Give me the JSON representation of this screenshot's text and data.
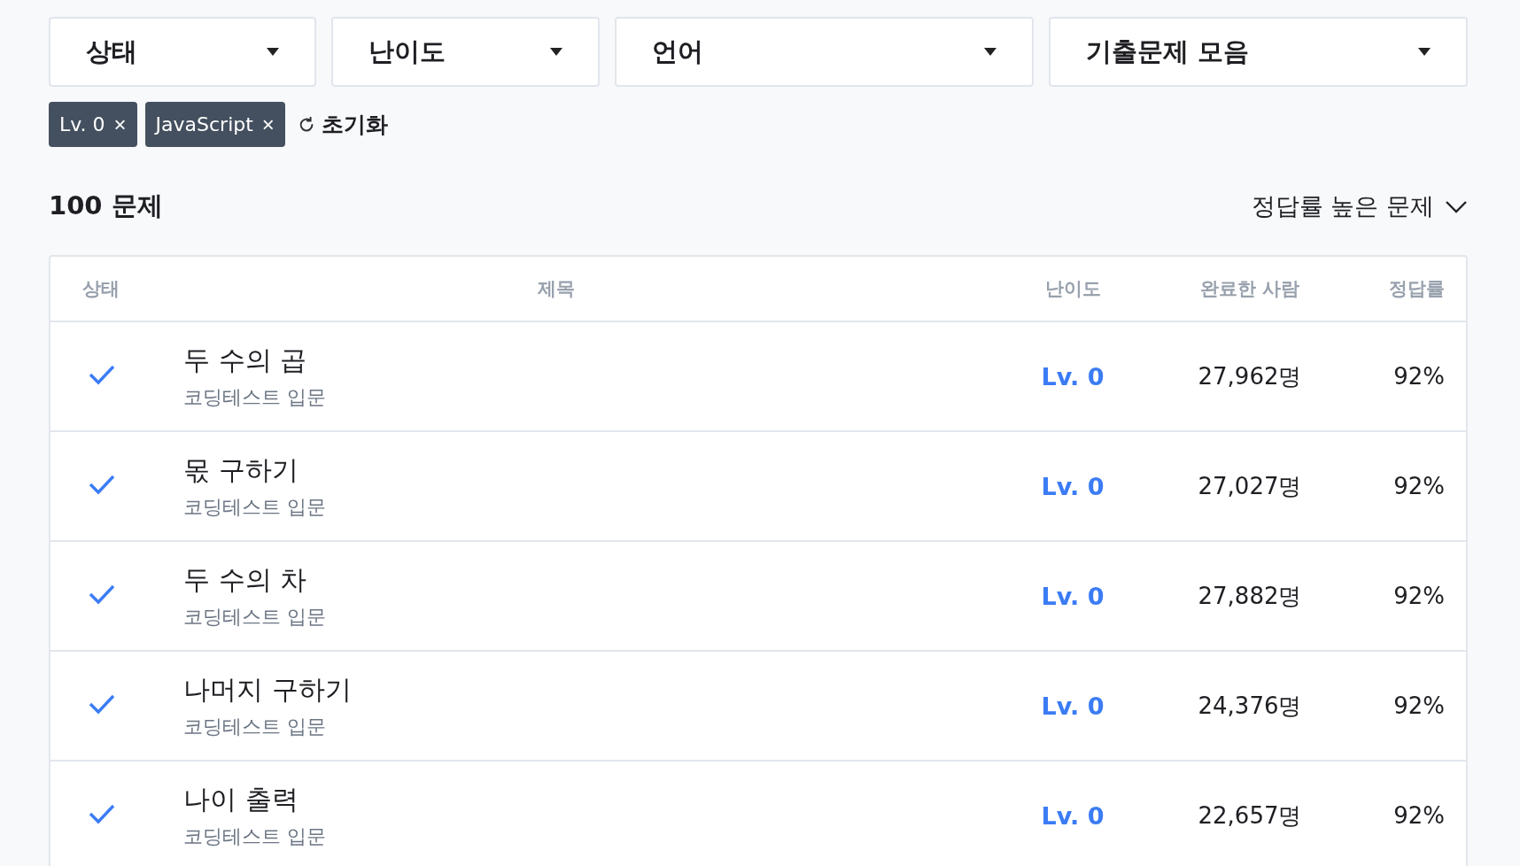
{
  "filters": [
    {
      "label": "상태"
    },
    {
      "label": "난이도"
    },
    {
      "label": "언어"
    },
    {
      "label": "기출문제 모음"
    }
  ],
  "chips": [
    {
      "label": "Lv. 0",
      "remove": "×"
    },
    {
      "label": "JavaScript",
      "remove": "×"
    }
  ],
  "reset": "초기화",
  "count": "100 문제",
  "sort": "정답률 높은 문제",
  "table": {
    "columns": [
      "상태",
      "제목",
      "난이도",
      "완료한 사람",
      "정답률"
    ],
    "rows": [
      {
        "solved": true,
        "title": "두 수의 곱",
        "category": "코딩테스트 입문",
        "level": "Lv. 0",
        "completed": "27,962명",
        "rate": "92%"
      },
      {
        "solved": true,
        "title": "몫 구하기",
        "category": "코딩테스트 입문",
        "level": "Lv. 0",
        "completed": "27,027명",
        "rate": "92%"
      },
      {
        "solved": true,
        "title": "두 수의 차",
        "category": "코딩테스트 입문",
        "level": "Lv. 0",
        "completed": "27,882명",
        "rate": "92%"
      },
      {
        "solved": true,
        "title": "나머지 구하기",
        "category": "코딩테스트 입문",
        "level": "Lv. 0",
        "completed": "24,376명",
        "rate": "92%"
      },
      {
        "solved": true,
        "title": "나이 출력",
        "category": "코딩테스트 입문",
        "level": "Lv. 0",
        "completed": "22,657명",
        "rate": "92%"
      }
    ]
  }
}
